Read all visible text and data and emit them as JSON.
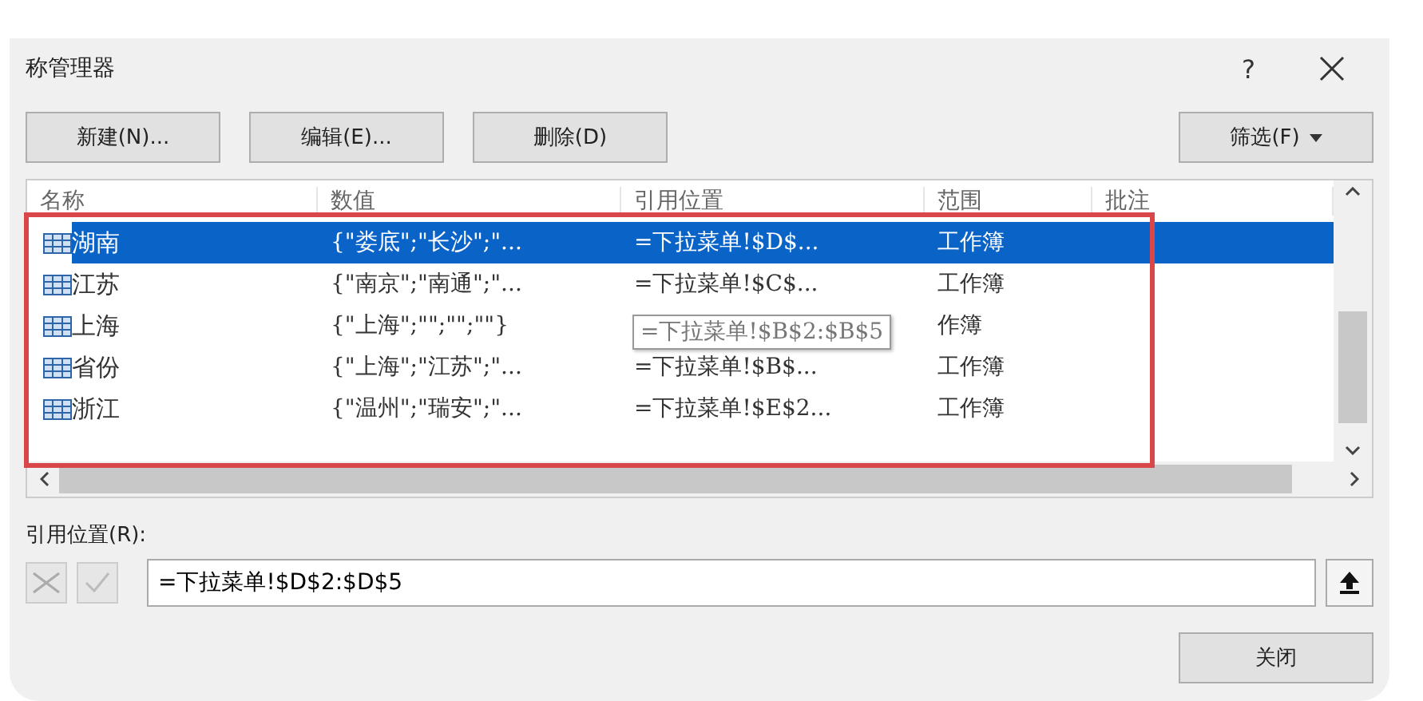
{
  "window": {
    "title": "称管理器",
    "help": "?"
  },
  "toolbar": {
    "buttons": [
      "新建(N)...",
      "编辑(E)...",
      "删除(D)"
    ],
    "filter": "筛选(F)"
  },
  "table": {
    "columns": [
      "名称",
      "数值",
      "引用位置",
      "范围",
      "批注"
    ],
    "rows": [
      {
        "name": "湖南",
        "value": "{\"娄底\";\"长沙\";\"...",
        "ref": "=下拉菜单!$D$...",
        "scope": "工作簿",
        "selected": true
      },
      {
        "name": "江苏",
        "value": "{\"南京\";\"南通\";\"...",
        "ref": "=下拉菜单!$C$...",
        "scope": "工作簿",
        "selected": false
      },
      {
        "name": "上海",
        "value": "{\"上海\";\"\";\"\";\"\"}",
        "ref": "",
        "scope": "作簿",
        "selected": false
      },
      {
        "name": "省份",
        "value": "{\"上海\";\"江苏\";\"...",
        "ref": "=下拉菜单!$B$...",
        "scope": "工作簿",
        "selected": false
      },
      {
        "name": "浙江",
        "value": "{\"温州\";\"瑞安\";\"...",
        "ref": "=下拉菜单!$E$2...",
        "scope": "工作簿",
        "selected": false
      }
    ],
    "tooltip": "=下拉菜单!$B$2:$B$5"
  },
  "ref_field": {
    "label": "引用位置(R):",
    "value": "=下拉菜单!$D$2:$D$5"
  },
  "close_button": "关闭"
}
